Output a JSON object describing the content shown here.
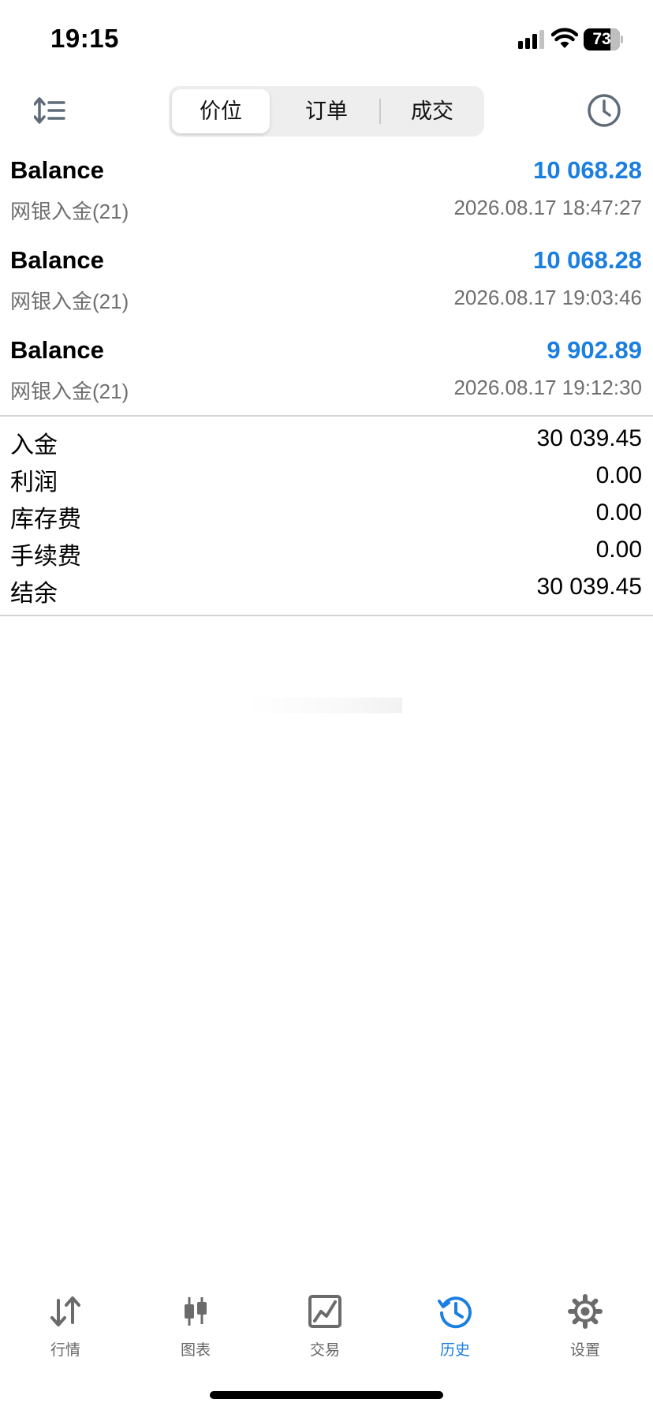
{
  "status": {
    "time": "19:15",
    "battery": "73"
  },
  "toolbar": {
    "tabs": [
      {
        "label": "价位",
        "active": true
      },
      {
        "label": "订单",
        "active": false
      },
      {
        "label": "成交",
        "active": false
      }
    ]
  },
  "records": [
    {
      "title": "Balance",
      "amount": "10 068.28",
      "subtitle": "网银入金(21)",
      "time": "2026.08.17 18:47:27"
    },
    {
      "title": "Balance",
      "amount": "10 068.28",
      "subtitle": "网银入金(21)",
      "time": "2026.08.17 19:03:46"
    },
    {
      "title": "Balance",
      "amount": "9 902.89",
      "subtitle": "网银入金(21)",
      "time": "2026.08.17 19:12:30"
    }
  ],
  "summary": [
    {
      "label": "入金",
      "value": "30 039.45"
    },
    {
      "label": "利润",
      "value": "0.00"
    },
    {
      "label": "库存费",
      "value": "0.00"
    },
    {
      "label": "手续费",
      "value": "0.00"
    },
    {
      "label": "结余",
      "value": "30 039.45"
    }
  ],
  "tab_bar": {
    "items": [
      {
        "label": "行情",
        "icon": "quotes-arrows-icon",
        "active": false
      },
      {
        "label": "图表",
        "icon": "chart-candles-icon",
        "active": false
      },
      {
        "label": "交易",
        "icon": "trade-chart-icon",
        "active": false
      },
      {
        "label": "历史",
        "icon": "history-clock-icon",
        "active": true
      },
      {
        "label": "设置",
        "icon": "gear-icon",
        "active": false
      }
    ]
  },
  "colors": {
    "accent": "#1a7fe0",
    "secondary_text": "#6f6f6f",
    "icon_gray": "#6b6b6b"
  }
}
